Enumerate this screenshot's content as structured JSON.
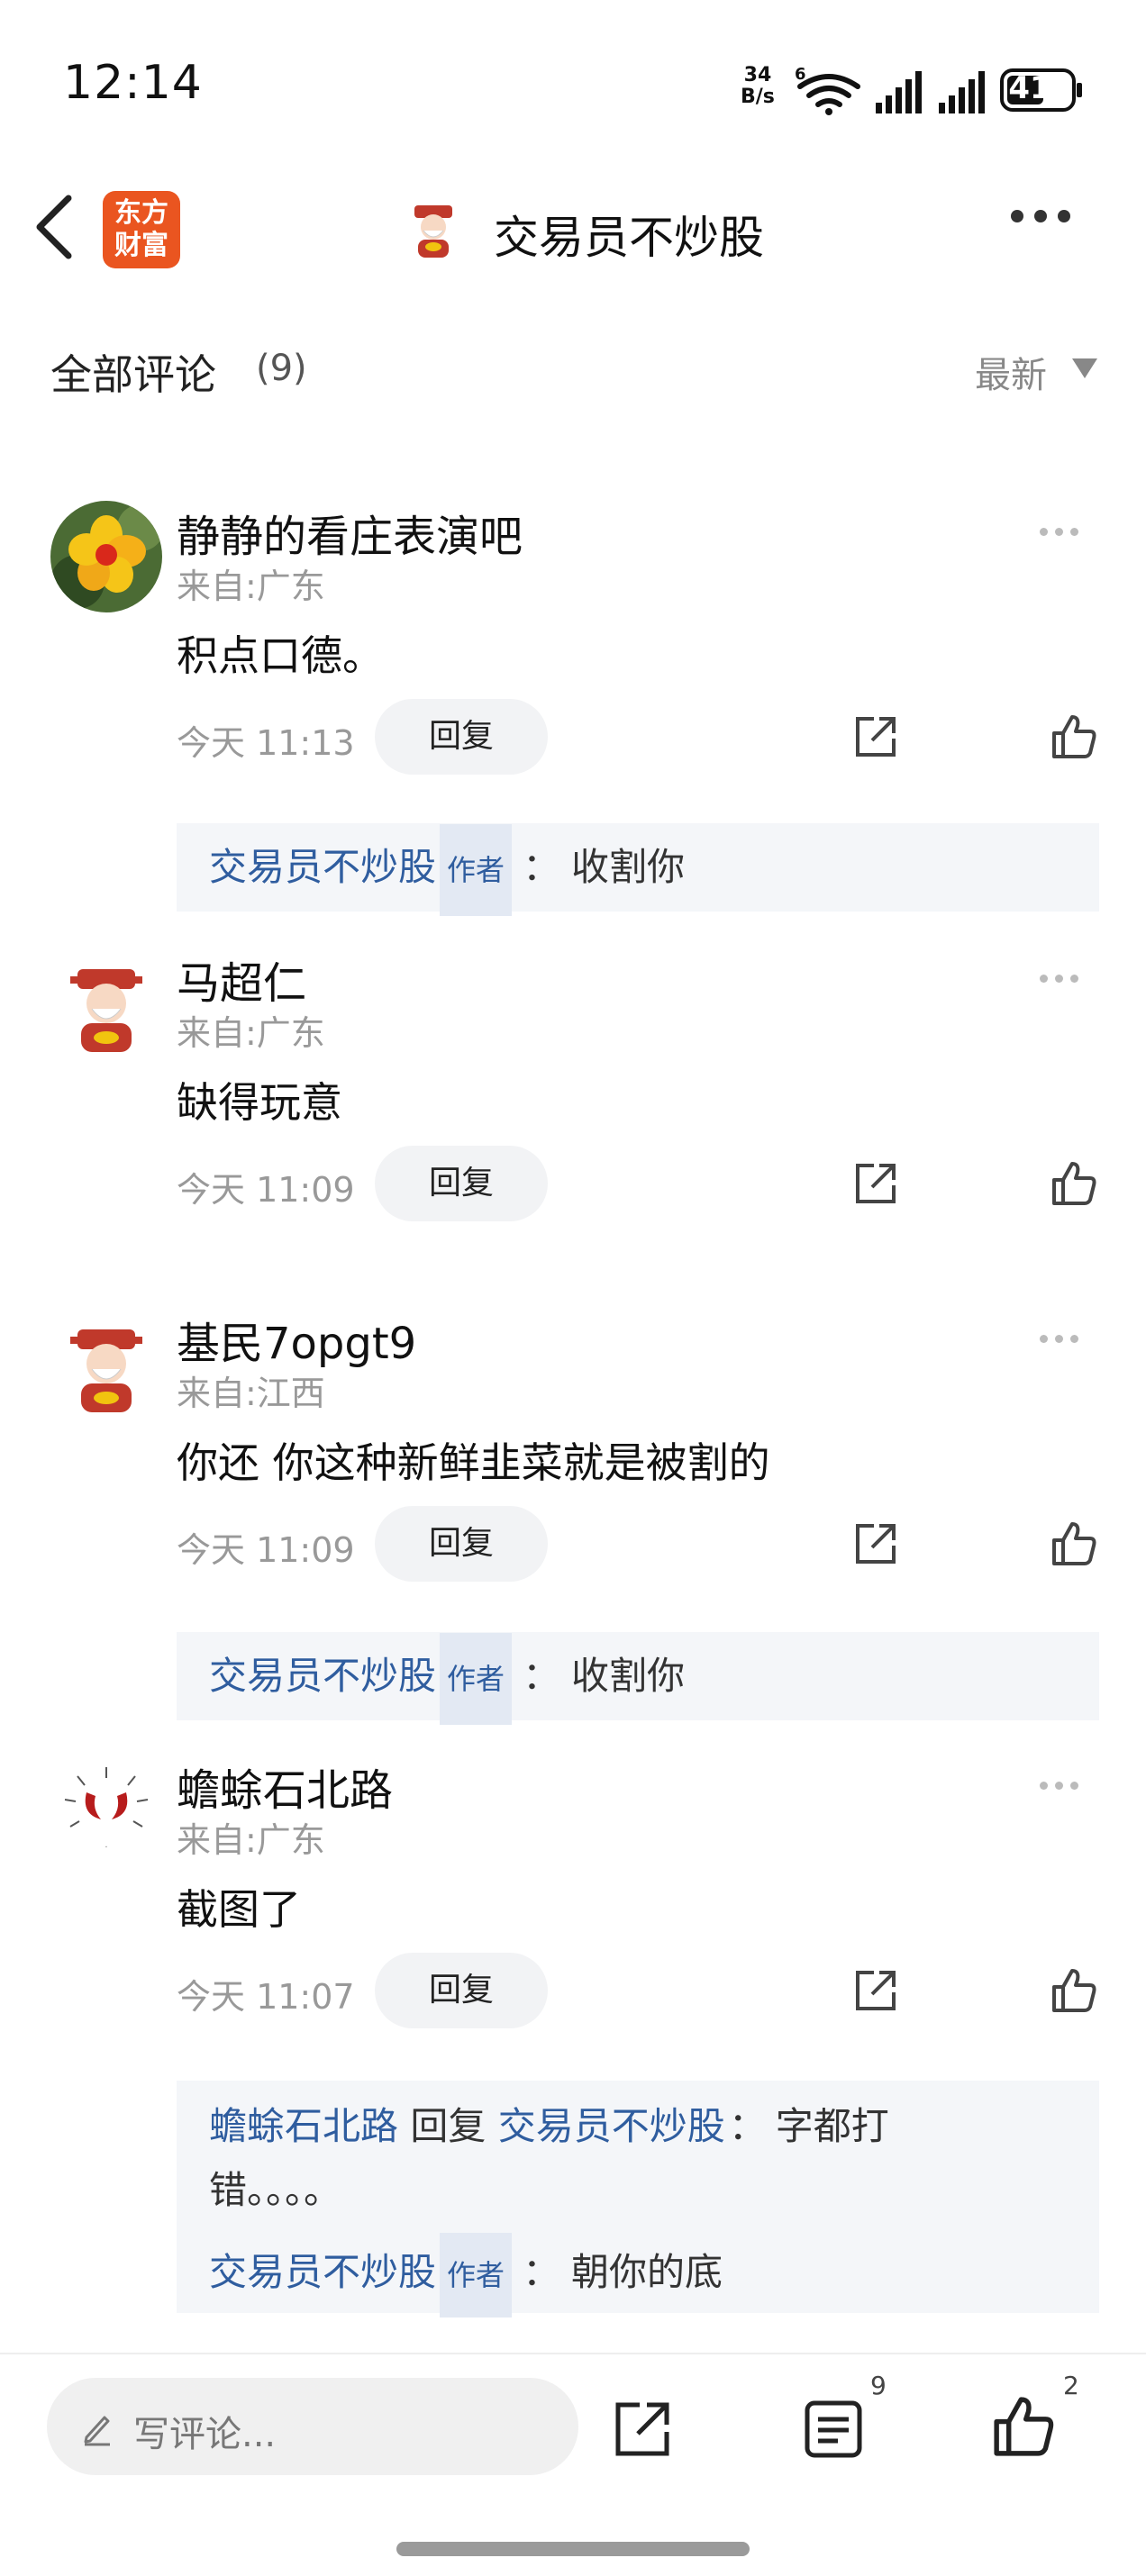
{
  "status_bar": {
    "time": "12:14",
    "net_speed_top": "34",
    "net_speed_bottom": "B/s",
    "battery": "41"
  },
  "header": {
    "logo_line1": "东方",
    "logo_line2": "财富",
    "title": "交易员不炒股",
    "accent_color": "#ea5520"
  },
  "section": {
    "title": "全部评论",
    "count": "(9)",
    "sort_label": "最新"
  },
  "comments": [
    {
      "name": "静静的看庄表演吧",
      "location": "来自:广东",
      "text": "积点口德。",
      "time": "今天 11:13",
      "reply_label": "回复",
      "reply": {
        "user": "交易员不炒股",
        "tag": "作者",
        "sep": "：",
        "text": "收割你"
      }
    },
    {
      "name": "马超仁",
      "location": "来自:广东",
      "text": "缺得玩意",
      "time": "今天 11:09",
      "reply_label": "回复"
    },
    {
      "name": "基民7opgt9",
      "location": "来自:江西",
      "text": "你还 你这种新鲜韭菜就是被割的",
      "time": "今天 11:09",
      "reply_label": "回复",
      "reply": {
        "user": "交易员不炒股",
        "tag": "作者",
        "sep": "：",
        "text": "收割你"
      }
    },
    {
      "name": "蟾蜍石北路",
      "location": "来自:广东",
      "text": "截图了",
      "time": "今天 11:07",
      "reply_label": "回复",
      "nested_reply": {
        "user": "蟾蜍石北路",
        "mid": " 回复 ",
        "target": "交易员不炒股",
        "sep": "：",
        "text_line1": "字都打",
        "text_line2": "错。。。。"
      },
      "reply": {
        "user": "交易员不炒股",
        "tag": "作者",
        "sep": "：",
        "text": "朝你的底"
      }
    }
  ],
  "bottom_bar": {
    "write_placeholder": "写评论...",
    "comment_count": "9",
    "like_count": "2"
  }
}
